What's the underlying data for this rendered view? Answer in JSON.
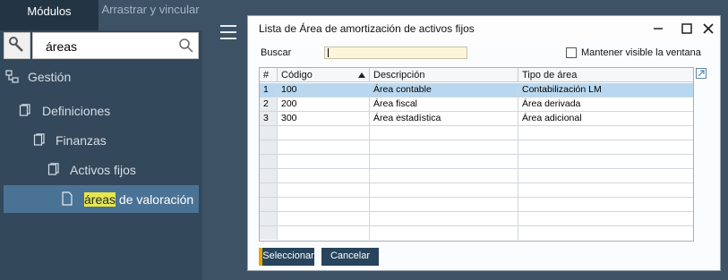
{
  "left_panel": {
    "tabs": [
      {
        "label": "Módulos"
      },
      {
        "label": "Arrastrar y vincular"
      }
    ],
    "search": {
      "value": "áreas"
    },
    "tree": [
      {
        "label": "Gestión"
      },
      {
        "label": "Definiciones"
      },
      {
        "label": "Finanzas"
      },
      {
        "label": "Activos fijos"
      },
      {
        "label_highlight": "áreas",
        "label_rest": " de valoración"
      }
    ]
  },
  "dialog": {
    "title": "Lista de Área de amortización de activos fijos",
    "search_label": "Buscar",
    "search_value": "",
    "keep_visible_label": "Mantener visible la ventana",
    "keep_visible_checked": false,
    "table": {
      "columns": [
        "#",
        "Código",
        "Descripción",
        "Tipo de área"
      ],
      "sorted_column": "Código",
      "rows": [
        {
          "num": "1",
          "codigo": "100",
          "descripcion": "Área contable",
          "tipo": "Contabilización LM",
          "selected": true
        },
        {
          "num": "2",
          "codigo": "200",
          "descripcion": "Área fiscal",
          "tipo": "Área derivada",
          "selected": false
        },
        {
          "num": "3",
          "codigo": "300",
          "descripcion": "Área estadística",
          "tipo": "Área adicional",
          "selected": false
        }
      ]
    },
    "buttons": {
      "select": "Seleccionar",
      "cancel": "Cancelar"
    }
  },
  "colors": {
    "background": "#3d5264",
    "panel": "#33485a",
    "selected_tree_item": "#4a7294",
    "highlight": "#e7e74a",
    "button": "#28445d",
    "button_accent": "#e8a500",
    "selected_row": "#b9d8f0"
  },
  "icons": [
    "wrench-icon",
    "search-icon",
    "hierarchy-icon",
    "folder-icon",
    "document-icon",
    "hamburger-icon",
    "minimize-icon",
    "maximize-icon",
    "close-icon",
    "sort-up-icon",
    "expand-icon"
  ]
}
